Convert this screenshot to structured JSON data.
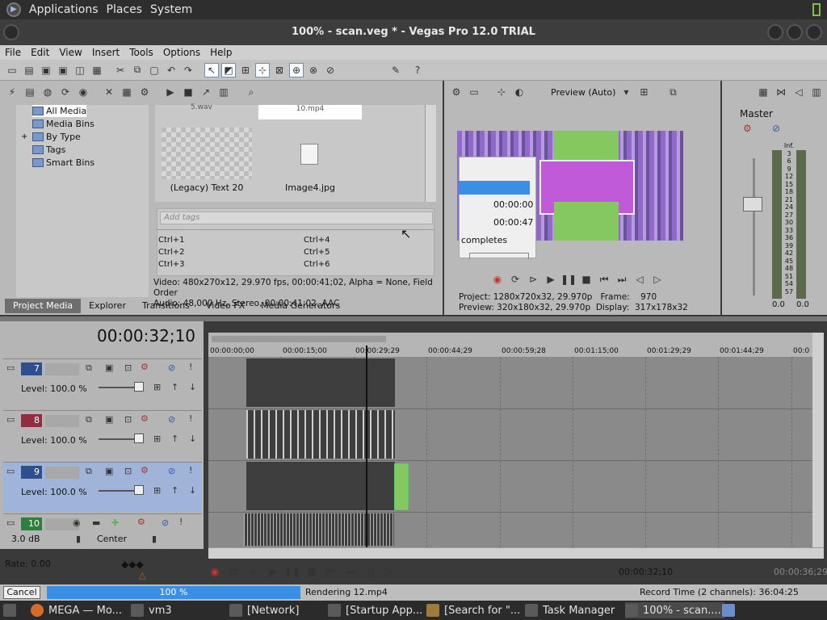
{
  "gnome": {
    "applications": "Applications",
    "places": "Places",
    "system": "System"
  },
  "window": {
    "title": "100% - scan.veg * - Vegas Pro 12.0 TRIAL"
  },
  "menu": [
    "File",
    "Edit",
    "View",
    "Insert",
    "Tools",
    "Options",
    "Help"
  ],
  "explorer": {
    "tree": [
      "All Media",
      "Media Bins",
      "By Type",
      "Tags",
      "Smart Bins"
    ],
    "tree_selected": "All Media",
    "media": [
      {
        "label": "(Legacy) Text 20"
      },
      {
        "label": "Image4.jpg"
      }
    ],
    "partial_labels": [
      "5.wav",
      "10.mp4"
    ],
    "tags_placeholder": "Add tags",
    "shortcuts": [
      "Ctrl+1",
      "Ctrl+4",
      "Ctrl+2",
      "Ctrl+5",
      "Ctrl+3",
      "Ctrl+6"
    ],
    "info_video": "Video: 480x270x12, 29.970 fps, 00:00:41;02, Alpha = None, Field Order",
    "info_audio": "Audio: 48,000 Hz, Stereo, 00:00:41;02, AAC",
    "tabs": [
      "Project Media",
      "Explorer",
      "Transitions",
      "Video FX",
      "Media Generators"
    ],
    "active_tab": "Project Media"
  },
  "preview": {
    "mode": "Preview (Auto)",
    "popup": {
      "time1": "00:00:00",
      "time2": "00:00:47",
      "text": "completes"
    },
    "project": "Project:  1280x720x32, 29.970p",
    "preview_info": "Preview:  320x180x32, 29.970p",
    "frame_label": "Frame:",
    "frame": "970",
    "display_label": "Display:",
    "display": "317x178x32"
  },
  "master": {
    "label": "Master",
    "scale": [
      "Inf.",
      "3",
      "6",
      "9",
      "12",
      "15",
      "18",
      "21",
      "24",
      "27",
      "30",
      "33",
      "36",
      "39",
      "42",
      "45",
      "48",
      "51",
      "54",
      "57"
    ],
    "left_val": "0.0",
    "right_val": "0.0"
  },
  "timeline": {
    "timecode": "00:00:32;10",
    "ruler": [
      "00:00:00;00",
      "00:00:15;00",
      "00:00:29;29",
      "00:00:44;29",
      "00:00:59;28",
      "00:01:15;00",
      "00:01:29;29",
      "00:01:44;29",
      "00:0"
    ],
    "tracks": [
      {
        "num": "7",
        "level": "Level:  100.0 %",
        "color": "#2e4e8e"
      },
      {
        "num": "8",
        "level": "Level:  100.0 %",
        "color": "#8e2e3e"
      },
      {
        "num": "9",
        "level": "Level:  100.0 %",
        "color": "#2e4e8e"
      },
      {
        "num": "10",
        "db": "3.0 dB",
        "pan": "Center",
        "color": "#2e7e3e"
      }
    ],
    "rate": "Rate: 0.00",
    "cursor_time": "00:00:32;10",
    "end_time": "00:00:36;29"
  },
  "status": {
    "cancel": "Cancel",
    "progress": "100 %",
    "progress_value": 1.0,
    "rendering": "Rendering 12.mp4",
    "record": "Record Time (2 channels): 36:04:25"
  },
  "taskbar": [
    {
      "label": "MEGA — Mo..."
    },
    {
      "label": "vm3"
    },
    {
      "label": "[Network]"
    },
    {
      "label": "[Startup App..."
    },
    {
      "label": "[Search for \"..."
    },
    {
      "label": "Task Manager"
    },
    {
      "label": "100% - scan...."
    }
  ]
}
